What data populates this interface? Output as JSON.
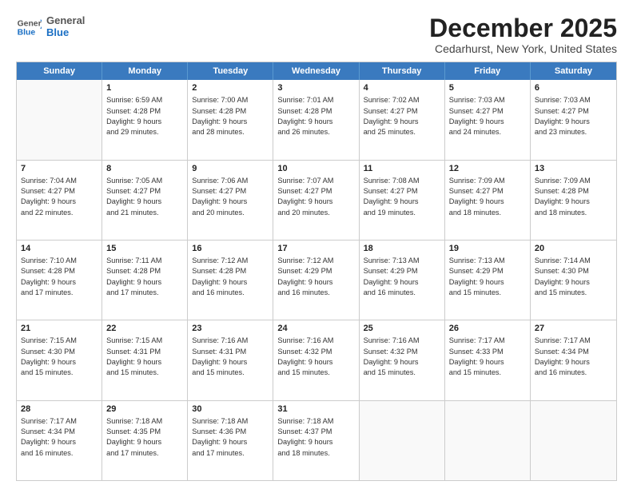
{
  "logo": {
    "general": "General",
    "blue": "Blue"
  },
  "title": "December 2025",
  "location": "Cedarhurst, New York, United States",
  "header_days": [
    "Sunday",
    "Monday",
    "Tuesday",
    "Wednesday",
    "Thursday",
    "Friday",
    "Saturday"
  ],
  "weeks": [
    [
      {
        "day": "",
        "sunrise": "",
        "sunset": "",
        "daylight": ""
      },
      {
        "day": "1",
        "sunrise": "Sunrise: 6:59 AM",
        "sunset": "Sunset: 4:28 PM",
        "daylight": "Daylight: 9 hours and 29 minutes."
      },
      {
        "day": "2",
        "sunrise": "Sunrise: 7:00 AM",
        "sunset": "Sunset: 4:28 PM",
        "daylight": "Daylight: 9 hours and 28 minutes."
      },
      {
        "day": "3",
        "sunrise": "Sunrise: 7:01 AM",
        "sunset": "Sunset: 4:28 PM",
        "daylight": "Daylight: 9 hours and 26 minutes."
      },
      {
        "day": "4",
        "sunrise": "Sunrise: 7:02 AM",
        "sunset": "Sunset: 4:27 PM",
        "daylight": "Daylight: 9 hours and 25 minutes."
      },
      {
        "day": "5",
        "sunrise": "Sunrise: 7:03 AM",
        "sunset": "Sunset: 4:27 PM",
        "daylight": "Daylight: 9 hours and 24 minutes."
      },
      {
        "day": "6",
        "sunrise": "Sunrise: 7:03 AM",
        "sunset": "Sunset: 4:27 PM",
        "daylight": "Daylight: 9 hours and 23 minutes."
      }
    ],
    [
      {
        "day": "7",
        "sunrise": "Sunrise: 7:04 AM",
        "sunset": "Sunset: 4:27 PM",
        "daylight": "Daylight: 9 hours and 22 minutes."
      },
      {
        "day": "8",
        "sunrise": "Sunrise: 7:05 AM",
        "sunset": "Sunset: 4:27 PM",
        "daylight": "Daylight: 9 hours and 21 minutes."
      },
      {
        "day": "9",
        "sunrise": "Sunrise: 7:06 AM",
        "sunset": "Sunset: 4:27 PM",
        "daylight": "Daylight: 9 hours and 20 minutes."
      },
      {
        "day": "10",
        "sunrise": "Sunrise: 7:07 AM",
        "sunset": "Sunset: 4:27 PM",
        "daylight": "Daylight: 9 hours and 20 minutes."
      },
      {
        "day": "11",
        "sunrise": "Sunrise: 7:08 AM",
        "sunset": "Sunset: 4:27 PM",
        "daylight": "Daylight: 9 hours and 19 minutes."
      },
      {
        "day": "12",
        "sunrise": "Sunrise: 7:09 AM",
        "sunset": "Sunset: 4:27 PM",
        "daylight": "Daylight: 9 hours and 18 minutes."
      },
      {
        "day": "13",
        "sunrise": "Sunrise: 7:09 AM",
        "sunset": "Sunset: 4:28 PM",
        "daylight": "Daylight: 9 hours and 18 minutes."
      }
    ],
    [
      {
        "day": "14",
        "sunrise": "Sunrise: 7:10 AM",
        "sunset": "Sunset: 4:28 PM",
        "daylight": "Daylight: 9 hours and 17 minutes."
      },
      {
        "day": "15",
        "sunrise": "Sunrise: 7:11 AM",
        "sunset": "Sunset: 4:28 PM",
        "daylight": "Daylight: 9 hours and 17 minutes."
      },
      {
        "day": "16",
        "sunrise": "Sunrise: 7:12 AM",
        "sunset": "Sunset: 4:28 PM",
        "daylight": "Daylight: 9 hours and 16 minutes."
      },
      {
        "day": "17",
        "sunrise": "Sunrise: 7:12 AM",
        "sunset": "Sunset: 4:29 PM",
        "daylight": "Daylight: 9 hours and 16 minutes."
      },
      {
        "day": "18",
        "sunrise": "Sunrise: 7:13 AM",
        "sunset": "Sunset: 4:29 PM",
        "daylight": "Daylight: 9 hours and 16 minutes."
      },
      {
        "day": "19",
        "sunrise": "Sunrise: 7:13 AM",
        "sunset": "Sunset: 4:29 PM",
        "daylight": "Daylight: 9 hours and 15 minutes."
      },
      {
        "day": "20",
        "sunrise": "Sunrise: 7:14 AM",
        "sunset": "Sunset: 4:30 PM",
        "daylight": "Daylight: 9 hours and 15 minutes."
      }
    ],
    [
      {
        "day": "21",
        "sunrise": "Sunrise: 7:15 AM",
        "sunset": "Sunset: 4:30 PM",
        "daylight": "Daylight: 9 hours and 15 minutes."
      },
      {
        "day": "22",
        "sunrise": "Sunrise: 7:15 AM",
        "sunset": "Sunset: 4:31 PM",
        "daylight": "Daylight: 9 hours and 15 minutes."
      },
      {
        "day": "23",
        "sunrise": "Sunrise: 7:16 AM",
        "sunset": "Sunset: 4:31 PM",
        "daylight": "Daylight: 9 hours and 15 minutes."
      },
      {
        "day": "24",
        "sunrise": "Sunrise: 7:16 AM",
        "sunset": "Sunset: 4:32 PM",
        "daylight": "Daylight: 9 hours and 15 minutes."
      },
      {
        "day": "25",
        "sunrise": "Sunrise: 7:16 AM",
        "sunset": "Sunset: 4:32 PM",
        "daylight": "Daylight: 9 hours and 15 minutes."
      },
      {
        "day": "26",
        "sunrise": "Sunrise: 7:17 AM",
        "sunset": "Sunset: 4:33 PM",
        "daylight": "Daylight: 9 hours and 15 minutes."
      },
      {
        "day": "27",
        "sunrise": "Sunrise: 7:17 AM",
        "sunset": "Sunset: 4:34 PM",
        "daylight": "Daylight: 9 hours and 16 minutes."
      }
    ],
    [
      {
        "day": "28",
        "sunrise": "Sunrise: 7:17 AM",
        "sunset": "Sunset: 4:34 PM",
        "daylight": "Daylight: 9 hours and 16 minutes."
      },
      {
        "day": "29",
        "sunrise": "Sunrise: 7:18 AM",
        "sunset": "Sunset: 4:35 PM",
        "daylight": "Daylight: 9 hours and 17 minutes."
      },
      {
        "day": "30",
        "sunrise": "Sunrise: 7:18 AM",
        "sunset": "Sunset: 4:36 PM",
        "daylight": "Daylight: 9 hours and 17 minutes."
      },
      {
        "day": "31",
        "sunrise": "Sunrise: 7:18 AM",
        "sunset": "Sunset: 4:37 PM",
        "daylight": "Daylight: 9 hours and 18 minutes."
      },
      {
        "day": "",
        "sunrise": "",
        "sunset": "",
        "daylight": ""
      },
      {
        "day": "",
        "sunrise": "",
        "sunset": "",
        "daylight": ""
      },
      {
        "day": "",
        "sunrise": "",
        "sunset": "",
        "daylight": ""
      }
    ]
  ]
}
